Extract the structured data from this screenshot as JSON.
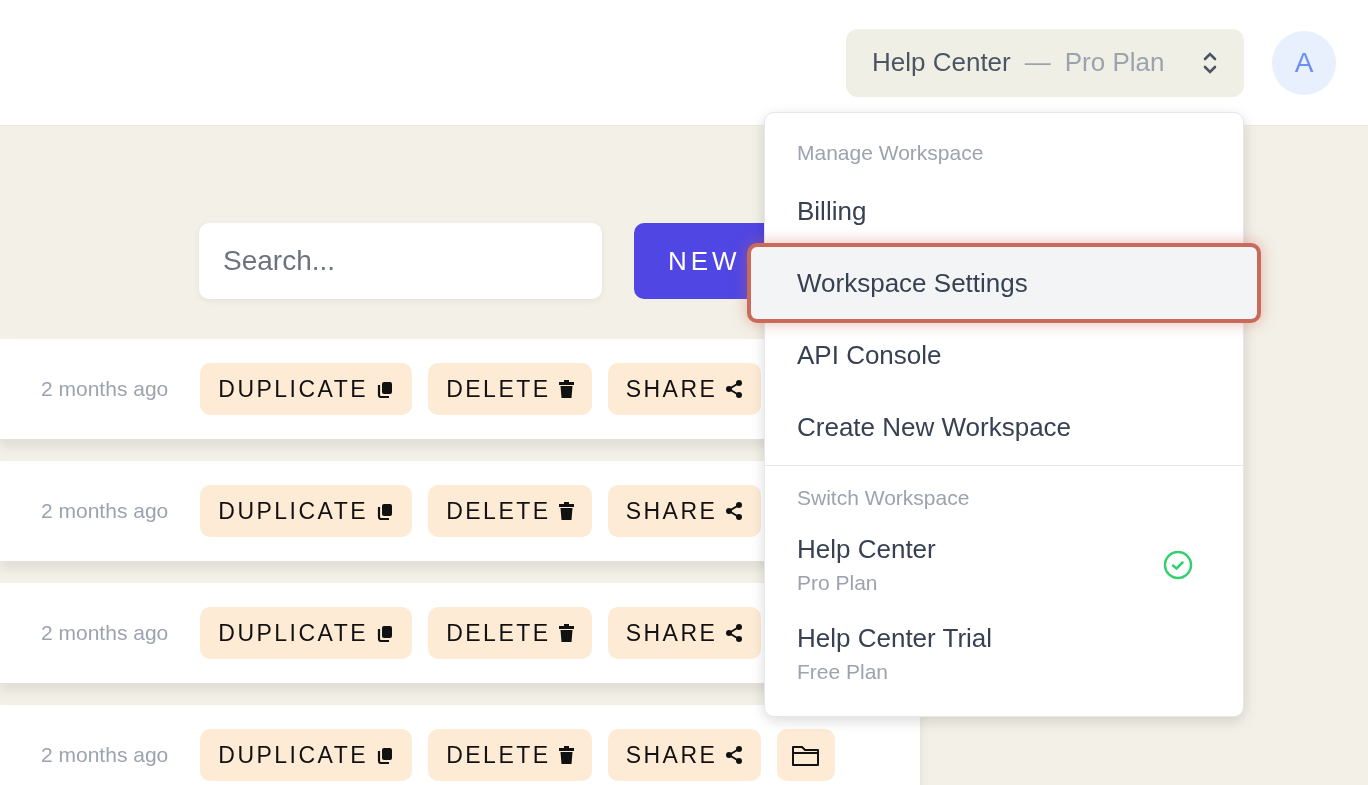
{
  "header": {
    "workspace_switcher": {
      "name": "Help Center",
      "separator": "—",
      "plan": "Pro Plan"
    },
    "avatar": {
      "initial": "A"
    }
  },
  "toolbar": {
    "search": {
      "placeholder": "Search..."
    },
    "new_button": {
      "label": "NEW"
    }
  },
  "rows": [
    {
      "time": "2 months ago",
      "duplicate": "DUPLICATE",
      "delete": "DELETE",
      "share": "SHARE"
    },
    {
      "time": "2 months ago",
      "duplicate": "DUPLICATE",
      "delete": "DELETE",
      "share": "SHARE"
    },
    {
      "time": "2 months ago",
      "duplicate": "DUPLICATE",
      "delete": "DELETE",
      "share": "SHARE"
    },
    {
      "time": "2 months ago",
      "duplicate": "DUPLICATE",
      "delete": "DELETE",
      "share": "SHARE"
    }
  ],
  "menu": {
    "manage_heading": "Manage Workspace",
    "items": [
      {
        "label": "Billing",
        "selected": false
      },
      {
        "label": "Workspace Settings",
        "selected": true
      },
      {
        "label": "API Console",
        "selected": false
      },
      {
        "label": "Create New Workspace",
        "selected": false
      }
    ],
    "switch_heading": "Switch Workspace",
    "workspaces": [
      {
        "name": "Help Center",
        "plan": "Pro Plan",
        "current": true
      },
      {
        "name": "Help Center Trial",
        "plan": "Free Plan",
        "current": false
      }
    ]
  }
}
